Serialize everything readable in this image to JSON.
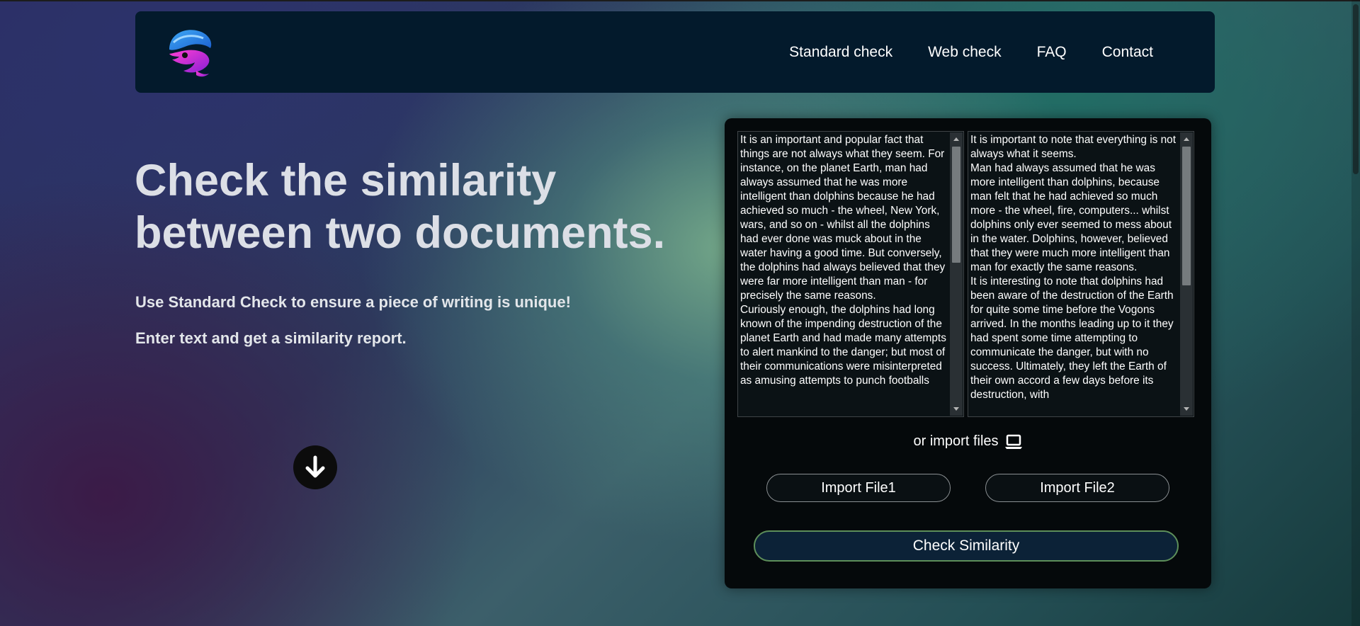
{
  "nav": {
    "links": [
      "Standard check",
      "Web check",
      "FAQ",
      "Contact"
    ]
  },
  "hero": {
    "title": "Check the similarity between two documents.",
    "subtitle": "Use Standard Check to ensure a piece of writing is unique!",
    "subtitle2": "Enter text and get a similarity report."
  },
  "icons": {
    "logo": "whale-logo-icon",
    "scroll": "arrow-down-icon",
    "import": "laptop-icon"
  },
  "panel": {
    "text1": "It is an important and popular fact that things are not always what they seem. For instance, on the planet Earth, man had always assumed that he was more intelligent than dolphins because he had achieved so much - the wheel, New York, wars, and so on - whilst all the dolphins had ever done was muck about in the water having a good time. But conversely, the dolphins had always believed that they were far more intelligent than man - for precisely the same reasons.\nCuriously enough, the dolphins had long known of the impending destruction of the planet Earth and had made many attempts to alert mankind to the danger; but most of their communications were misinterpreted as amusing attempts to punch footballs",
    "text2": "It is important to note that everything is not always what it seems.\nMan had always assumed that he was more intelligent than dolphins, because man felt that he had achieved so much more - the wheel, fire, computers... whilst dolphins only ever seemed to mess about in the water. Dolphins, however, believed that they were much more intelligent than man for exactly the same reasons.\nIt is interesting to note that dolphins had been aware of the destruction of the Earth for quite some time before the Vogons arrived. In the months leading up to it they had spent some time attempting to communicate the danger, but with no success. Ultimately, they left the Earth of their own accord a few days before its destruction, with",
    "import_label": "or import files",
    "import_file1": "Import File1",
    "import_file2": "Import File2",
    "check_button": "Check Similarity"
  },
  "colors": {
    "navbar_bg": "#031a2c",
    "panel_bg": "#05090b",
    "check_button_bg": "#0c2237",
    "check_button_border": "#5d8f5a"
  }
}
